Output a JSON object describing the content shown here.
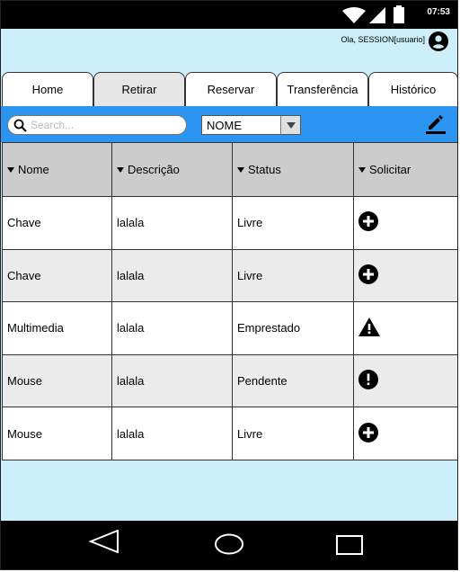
{
  "status_bar": {
    "time": "07:53",
    "icons": [
      "wifi-icon",
      "signal-icon",
      "battery-icon"
    ]
  },
  "header": {
    "greeting": "Ola, SESSION[usuario]",
    "user_icon": "account-circle-icon"
  },
  "tabs": [
    {
      "label": "Home",
      "active": false
    },
    {
      "label": "Retirar",
      "active": true
    },
    {
      "label": "Reservar",
      "active": false
    },
    {
      "label": "Transferência",
      "active": false
    },
    {
      "label": "Histórico",
      "active": false
    }
  ],
  "toolbar": {
    "search_placeholder": "Search...",
    "search_value": "",
    "filter_selected": "NOME",
    "edit_icon": "edit-icon"
  },
  "table": {
    "columns": [
      "Nome",
      "Descrição",
      "Status",
      "Solicitar"
    ],
    "rows": [
      {
        "nome": "Chave",
        "descricao": "lalala",
        "status": "Livre",
        "action_icon": "add-circle-icon"
      },
      {
        "nome": "Chave",
        "descricao": "lalala",
        "status": "Livre",
        "action_icon": "add-circle-icon"
      },
      {
        "nome": "Multimedia",
        "descricao": "lalala",
        "status": "Emprestado",
        "action_icon": "warning-icon"
      },
      {
        "nome": "Mouse",
        "descricao": "lalala",
        "status": "Pendente",
        "action_icon": "alert-circle-icon"
      },
      {
        "nome": "Mouse",
        "descricao": "lalala",
        "status": "Livre",
        "action_icon": "add-circle-icon"
      }
    ]
  },
  "nav_bar": {
    "icons": [
      "back-icon",
      "home-icon",
      "recents-icon"
    ]
  },
  "colors": {
    "background": "#cdeffc",
    "toolbar": "#2b95f1",
    "header_row": "#cccccc",
    "alt_row": "#ebebeb",
    "active_tab": "#e6e6e6"
  }
}
